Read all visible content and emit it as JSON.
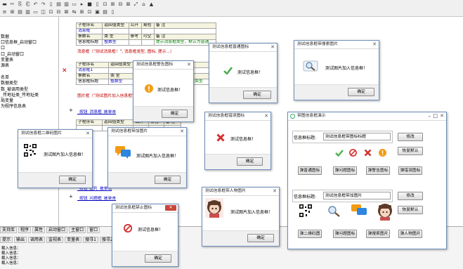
{
  "toolbar": {
    "row1": [
      "▬",
      "✂",
      "⎘",
      "⎗",
      "↶",
      "↷",
      "▯",
      "▤",
      "▥",
      "▭",
      "▸",
      "■",
      "▯",
      "⊡",
      "⊞",
      "⊟",
      "⊠",
      "⤢",
      "⌂",
      "▲"
    ],
    "row2": [
      "≡",
      "⊞",
      "▤",
      "▥",
      "▭",
      "◫",
      "⊡",
      "⊟",
      "⊠",
      "⇆",
      "⊞",
      "⊡",
      "▣",
      "▤",
      "▯"
    ]
  },
  "left_panel": {
    "lines": [
      "",
      "",
      "",
      "数据",
      "口信息框_启动窗口",
      "口",
      "口_启动窗口",
      "变量表",
      "源表",
      "",
      "名单",
      "数据类型",
      "数_被调用类型",
      "_传地址类_传地址类",
      "局变量",
      "为程序信息表",
      "",
      "",
      "",
      "",
      "",
      "",
      "",
      "",
      "",
      "",
      "",
      "",
      "",
      "",
      "",
      "",
      "",
      "",
      "",
      "",
      "",
      ""
    ]
  },
  "code": {
    "t1": {
      "h": [
        "子程序名",
        "返回值类型",
        "公开",
        "易包",
        "备 注"
      ],
      "r1": "消息框",
      "h2": [
        "参数名",
        "类 型",
        "参考",
        "可空",
        "数组",
        "备 注"
      ],
      "r2a": "信息框标题",
      "r2b": "整数型",
      "r2c": "提示消息框类型，默认为普通"
    },
    "call1": "消息框（\"测试消息框！\", 消息框类型, 图标, 提示...）",
    "t2": {
      "h": [
        "子程序名",
        "返回值类型",
        "公开",
        "易包",
        "备 注"
      ],
      "r1": "消息框1",
      "h2": [
        "参数名",
        "类 型",
        "参考",
        "可空",
        "数组",
        "备 注"
      ],
      "r2a": "信息框标题",
      "r2b": "整数型",
      "r2c": "提示消息框类型"
    },
    "call2": "图片框（\"测试图片加入信息框\", ...）",
    "sub3": "_按钮_消息框_被单击",
    "t3": {
      "h": [
        "子程序名",
        "返回值类型",
        "公开",
        "易包",
        "备 注"
      ]
    },
    "sub4": "_按钮_图片_被单击",
    "sub5": "_按钮_问题框_被单击"
  },
  "bottom": {
    "tabs": [
      "支持库",
      "程序",
      "属性",
      "启动窗口",
      "主窗口",
      "窗口"
    ],
    "tabs2": [
      "提示",
      "输出",
      "调用表",
      "监视表",
      "变量表",
      "搜寻1",
      "搜寻2",
      "剪辑历史"
    ],
    "output": [
      "载入信息：",
      "载入信息：",
      "载入信息：",
      "载入信息："
    ]
  },
  "dialogs": {
    "d_warn": {
      "title": "测试信息框警告图标",
      "msg": "测试信息框！",
      "ok": "确定"
    },
    "d_check": {
      "title": "测试信息框普通图标",
      "msg": "测试信息框！",
      "ok": "确定"
    },
    "d_search": {
      "title": "测试信息框带搜索图片",
      "msg": "测试图片加入信息框！",
      "ok": "确定"
    },
    "d_error": {
      "title": "测试信息框错误图标",
      "msg": "测试信息框！",
      "ok": "确定"
    },
    "d_qr": {
      "title": "测试信息框二维码图片",
      "msg": "测试图片加入信息框！",
      "ok": "确定"
    },
    "d_chat": {
      "title": "测试信息框带加图片",
      "msg": "测试图片加入信息框！",
      "ok": "确定"
    },
    "d_girl": {
      "title": "测试信息框带人物图片",
      "msg": "测试图片加入信息框！",
      "ok": "确定"
    },
    "d_stop": {
      "title": "测试信息框禁止图标",
      "msg": "测试信息框！",
      "ok": "确定"
    },
    "main": {
      "title": "带图信息框演示",
      "g1_label": "信息框标题:",
      "g1_value": "测试信息框带图标标题",
      "btn_change1": "修改",
      "btn_restore1": "恢复默认",
      "btns1": [
        "弹普通图标",
        "弹问题图标",
        "弹警告图标",
        "弹错误图标"
      ],
      "g2_label": "信息框标题:",
      "g2_value": "测试信息框带加图片",
      "btn_change2": "修改",
      "btn_restore2": "恢复默认",
      "btns2": [
        "弹二维码图",
        "弹问题图标",
        "弹搜索图片",
        "弹人物图片"
      ]
    }
  },
  "colors": {
    "accent_blue": "#0000c0",
    "code_green": "#008000",
    "error_red": "#d32f2f",
    "ok_green": "#4caf50",
    "warn_orange": "#f39c12"
  }
}
